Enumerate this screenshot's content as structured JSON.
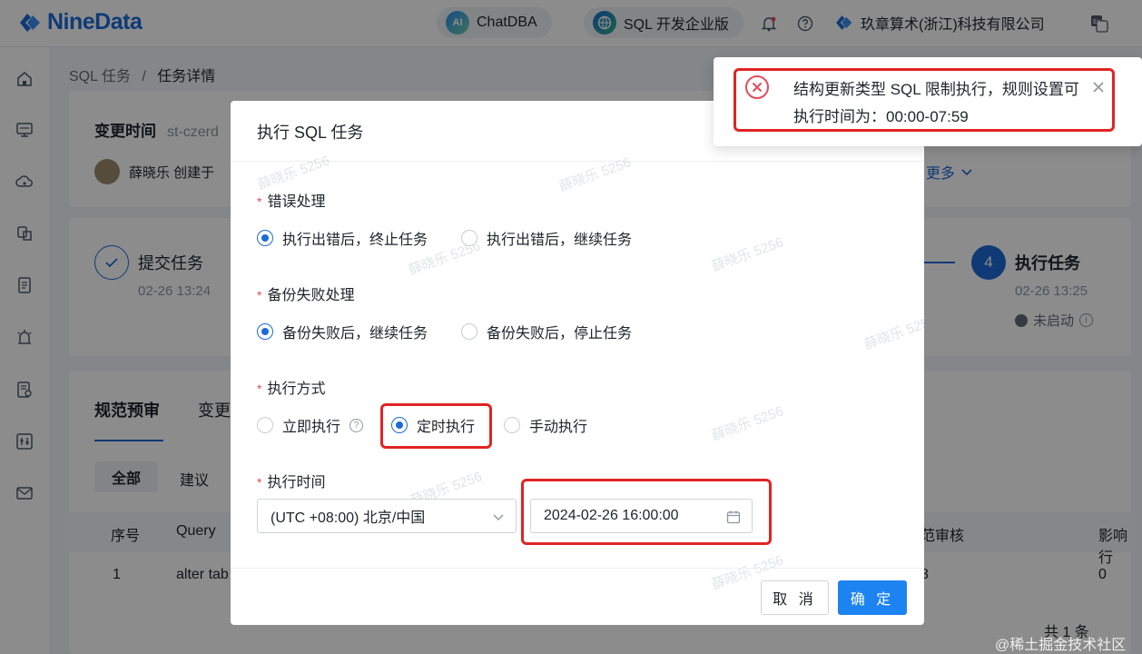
{
  "header": {
    "brand": "NineData",
    "chatdba_label": "ChatDBA",
    "chatdba_badge": "AI",
    "sql_edition_label": "SQL 开发企业版",
    "company": "玖章算术(浙江)科技有限公司"
  },
  "breadcrumb": {
    "parent": "SQL 任务",
    "separator": "/",
    "current": "任务详情"
  },
  "task": {
    "change_time_label": "变更时间",
    "task_id_partial": "st-czerd",
    "creator": "薛晓乐 创建于",
    "more": "更多"
  },
  "steps": [
    {
      "title": "提交任务",
      "time": "02-26 13:24"
    },
    {
      "number": "4",
      "title": "执行任务",
      "time": "02-26 13:25",
      "status": "未启动"
    }
  ],
  "tabs": [
    "规范预审",
    "变更"
  ],
  "filters": {
    "all": "全部",
    "suggest": "建议"
  },
  "table": {
    "headers": [
      "序号",
      "Query",
      "范审核",
      "影响行"
    ],
    "rows": [
      {
        "index": "1",
        "query": "alter tab",
        "review": "3",
        "affected": "0"
      }
    ],
    "total": "共 1 条"
  },
  "modal": {
    "title": "执行 SQL 任务",
    "error_handling": {
      "label": "错误处理",
      "options": [
        "执行出错后，终止任务",
        "执行出错后，继续任务"
      ],
      "selected": 0
    },
    "backup_failure": {
      "label": "备份失败处理",
      "options": [
        "备份失败后，继续任务",
        "备份失败后，停止任务"
      ],
      "selected": 0
    },
    "execution_mode": {
      "label": "执行方式",
      "options": [
        "立即执行",
        "定时执行",
        "手动执行"
      ],
      "selected": 1
    },
    "execution_time": {
      "label": "执行时间",
      "timezone": "(UTC +08:00) 北京/中国",
      "datetime": "2024-02-26 16:00:00"
    },
    "cancel_label": "取 消",
    "confirm_label": "确 定",
    "required_mark": "*"
  },
  "notification": {
    "message": "结构更新类型 SQL 限制执行，规则设置可执行时间为：00:00-07:59"
  },
  "watermark": "薛晓乐 5256",
  "footer_watermark": "@稀土掘金技术社区",
  "colors": {
    "primary": "#1d6bd8",
    "button_primary": "#1d83f0",
    "error": "#e34d59",
    "highlight": "#e02424"
  }
}
